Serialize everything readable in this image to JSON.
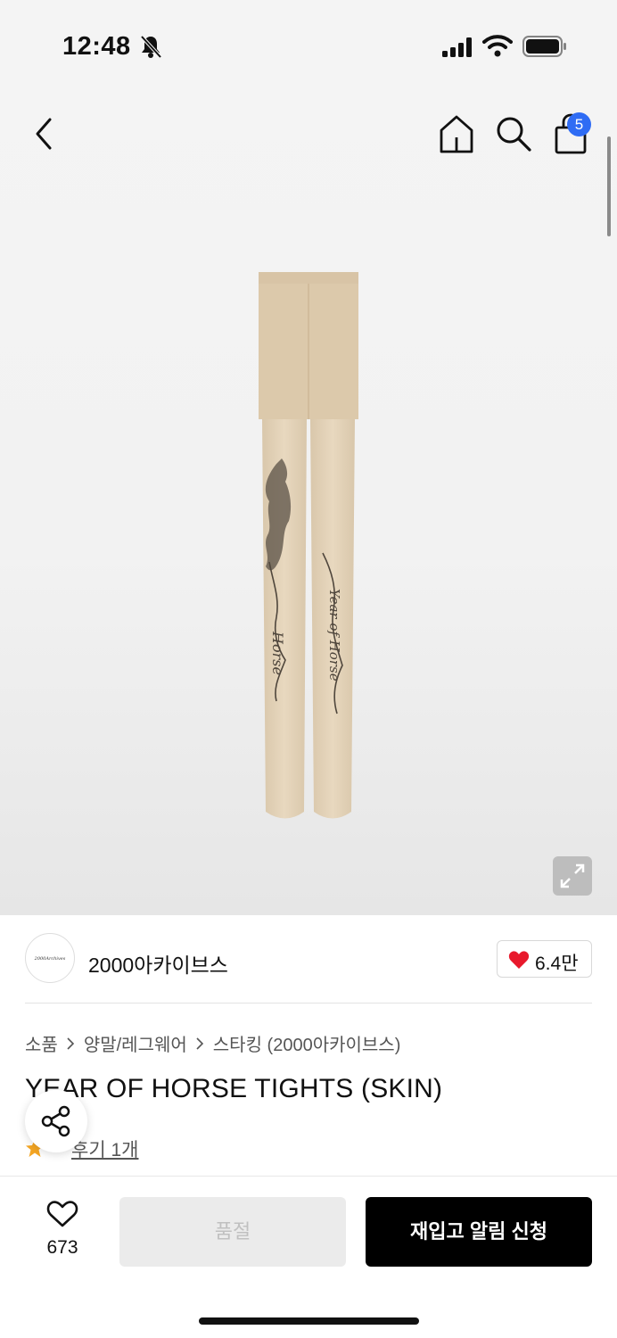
{
  "status": {
    "time": "12:48"
  },
  "header": {
    "cart_count": "5"
  },
  "seller": {
    "logo_text": "2000Archives",
    "name": "2000아카이브스",
    "likes": "6.4만"
  },
  "breadcrumb": [
    "소품",
    "양말/레그웨어",
    "스타킹 (2000아카이브스)"
  ],
  "product": {
    "title": "YEAR OF HORSE TIGHTS (SKIN)",
    "review_link": "후기 1개",
    "left_leg_text": "Horse",
    "right_leg_text": "Year of Horse"
  },
  "footer": {
    "wish_count": "673",
    "soldout_label": "품절",
    "restock_label": "재입고 알림 신청"
  },
  "colors": {
    "accent_blue": "#2f6cf4",
    "heart_red": "#e8192c",
    "star": "#f5a623",
    "tights": "#e3d2b8"
  }
}
